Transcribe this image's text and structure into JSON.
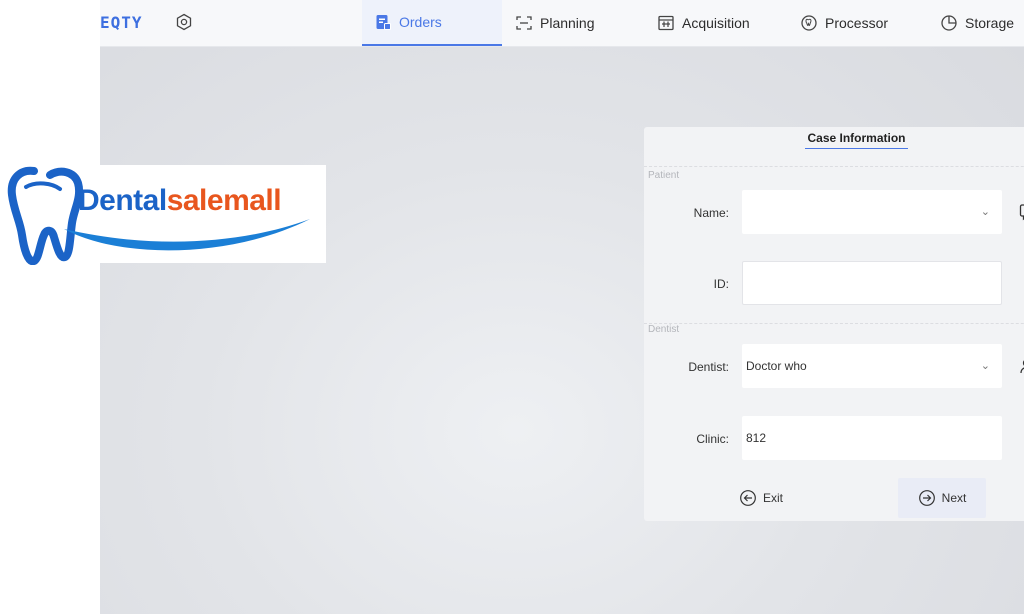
{
  "topbar": {
    "brand": "EQTY",
    "tabs": [
      {
        "label": "Orders",
        "icon": "orders-icon",
        "active": true
      },
      {
        "label": "Planning",
        "icon": "planning-icon"
      },
      {
        "label": "Acquisition",
        "icon": "acquisition-icon"
      },
      {
        "label": "Processor",
        "icon": "processor-icon"
      },
      {
        "label": "Storage",
        "icon": "storage-icon"
      }
    ]
  },
  "logo": {
    "text_part1": "Dental",
    "text_part2": "salemall"
  },
  "card": {
    "title": "Case Information",
    "patient_section": "Patient",
    "name_label": "Name:",
    "name_value": "",
    "id_label": "ID:",
    "id_value": "",
    "dentist_section": "Dentist",
    "dentist_label": "Dentist:",
    "dentist_value": "Doctor who",
    "clinic_label": "Clinic:",
    "clinic_value": "812",
    "exit_label": "Exit",
    "next_label": "Next"
  },
  "colors": {
    "accent": "#4a78e6",
    "logo_blue": "#1b63c7",
    "logo_orange": "#e8561e"
  }
}
